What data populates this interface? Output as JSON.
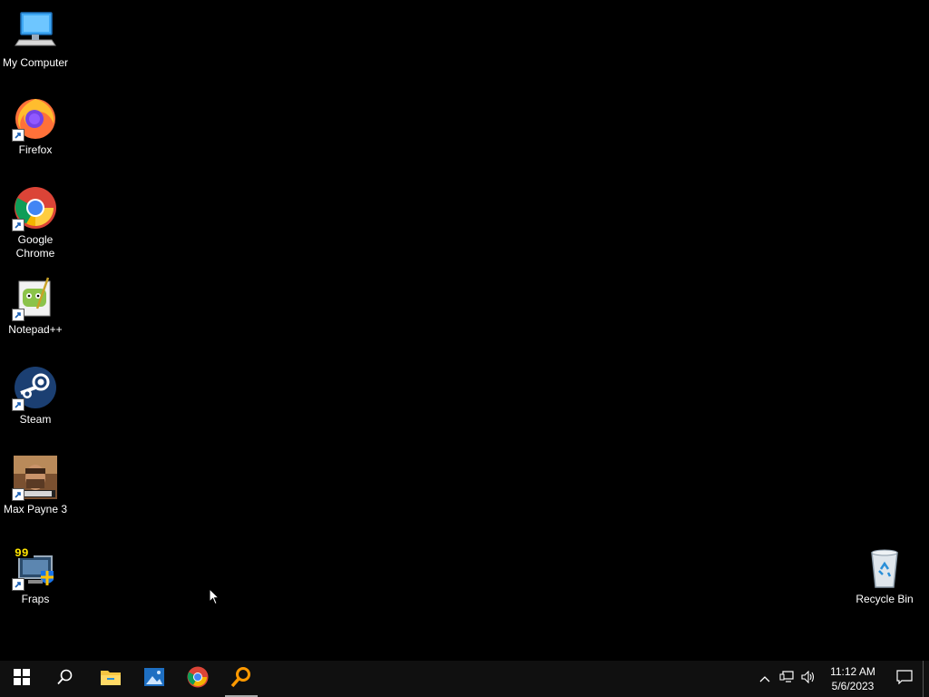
{
  "desktop": {
    "icons": [
      {
        "label": "My Computer"
      },
      {
        "label": "Firefox"
      },
      {
        "label": "Google Chrome"
      },
      {
        "label": "Notepad++"
      },
      {
        "label": "Steam"
      },
      {
        "label": "Max Payne 3"
      },
      {
        "label": "Fraps"
      },
      {
        "label": "Recycle Bin"
      }
    ]
  },
  "taskbar": {
    "buttons": [
      {
        "icon": "windows-start-icon"
      },
      {
        "icon": "search-icon"
      },
      {
        "icon": "file-explorer-icon"
      },
      {
        "icon": "photos-icon"
      },
      {
        "icon": "chrome-icon"
      },
      {
        "icon": "magnifier-icon"
      }
    ],
    "clock": {
      "time": "11:12 AM",
      "date": "5/6/2023"
    }
  },
  "colors": {
    "accent": "#0078d7",
    "taskbar": "#101010",
    "desktop": "#000000"
  }
}
